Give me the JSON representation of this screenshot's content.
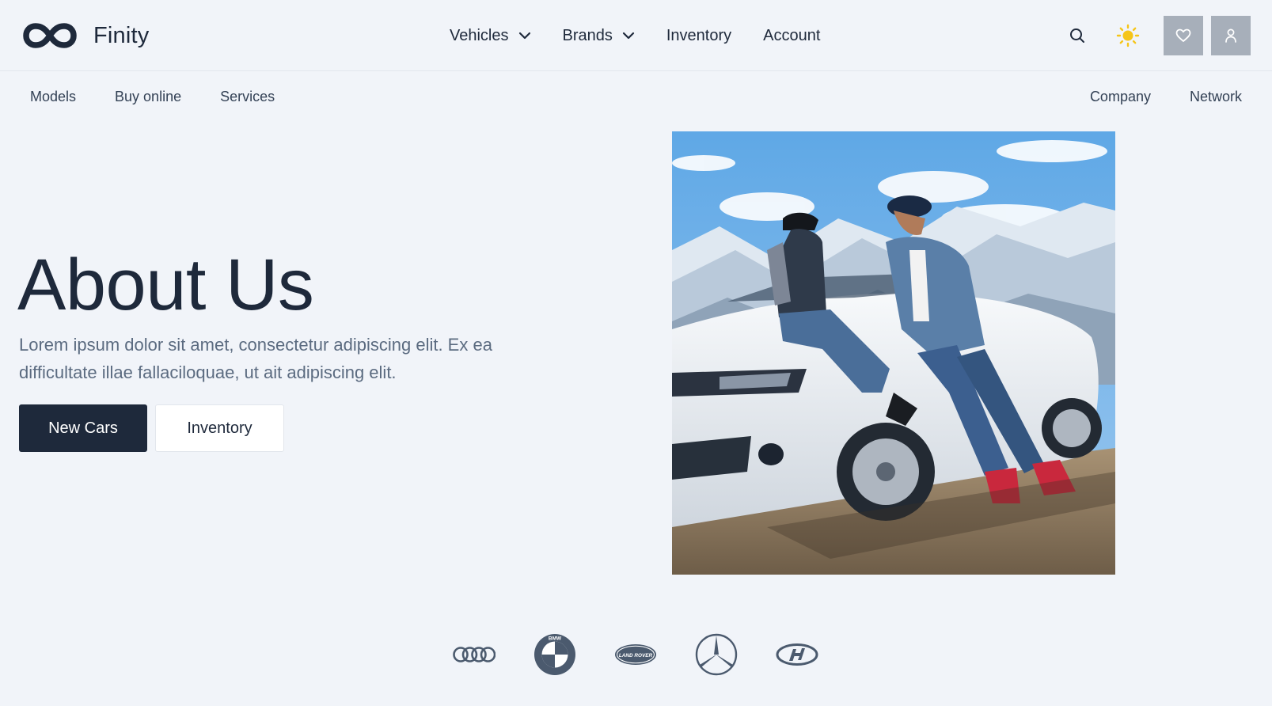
{
  "brand": {
    "name": "Finity",
    "logo_icon": "infinity-icon"
  },
  "main_nav": {
    "items": [
      {
        "label": "Vehicles",
        "has_dropdown": true
      },
      {
        "label": "Brands",
        "has_dropdown": true
      },
      {
        "label": "Inventory",
        "has_dropdown": false
      },
      {
        "label": "Account",
        "has_dropdown": false
      }
    ]
  },
  "actions": {
    "search_icon": "search-icon",
    "theme_icon": "sun-icon",
    "favorites_icon": "heart-icon",
    "user_icon": "user-icon",
    "accent_color": "#f5c518",
    "button_bg": "#a7afba"
  },
  "sub_nav": {
    "left": [
      "Models",
      "Buy online",
      "Services"
    ],
    "right": [
      "Company",
      "Network"
    ]
  },
  "hero": {
    "title": "About Us",
    "description": "Lorem ipsum dolor sit amet, consectetur adipiscing elit. Ex ea difficultate illae fallaciloquae, ut ait adipiscing elit.",
    "primary_button": "New Cars",
    "secondary_button": "Inventory",
    "primary_color": "#1e293b"
  },
  "brand_logos": [
    "audi-logo-icon",
    "bmw-logo-icon",
    "land-rover-logo-icon",
    "mercedes-logo-icon",
    "hyundai-logo-icon"
  ],
  "brand_logo_text": {
    "bmw": "BMW",
    "land_rover": "LAND ROVER"
  }
}
